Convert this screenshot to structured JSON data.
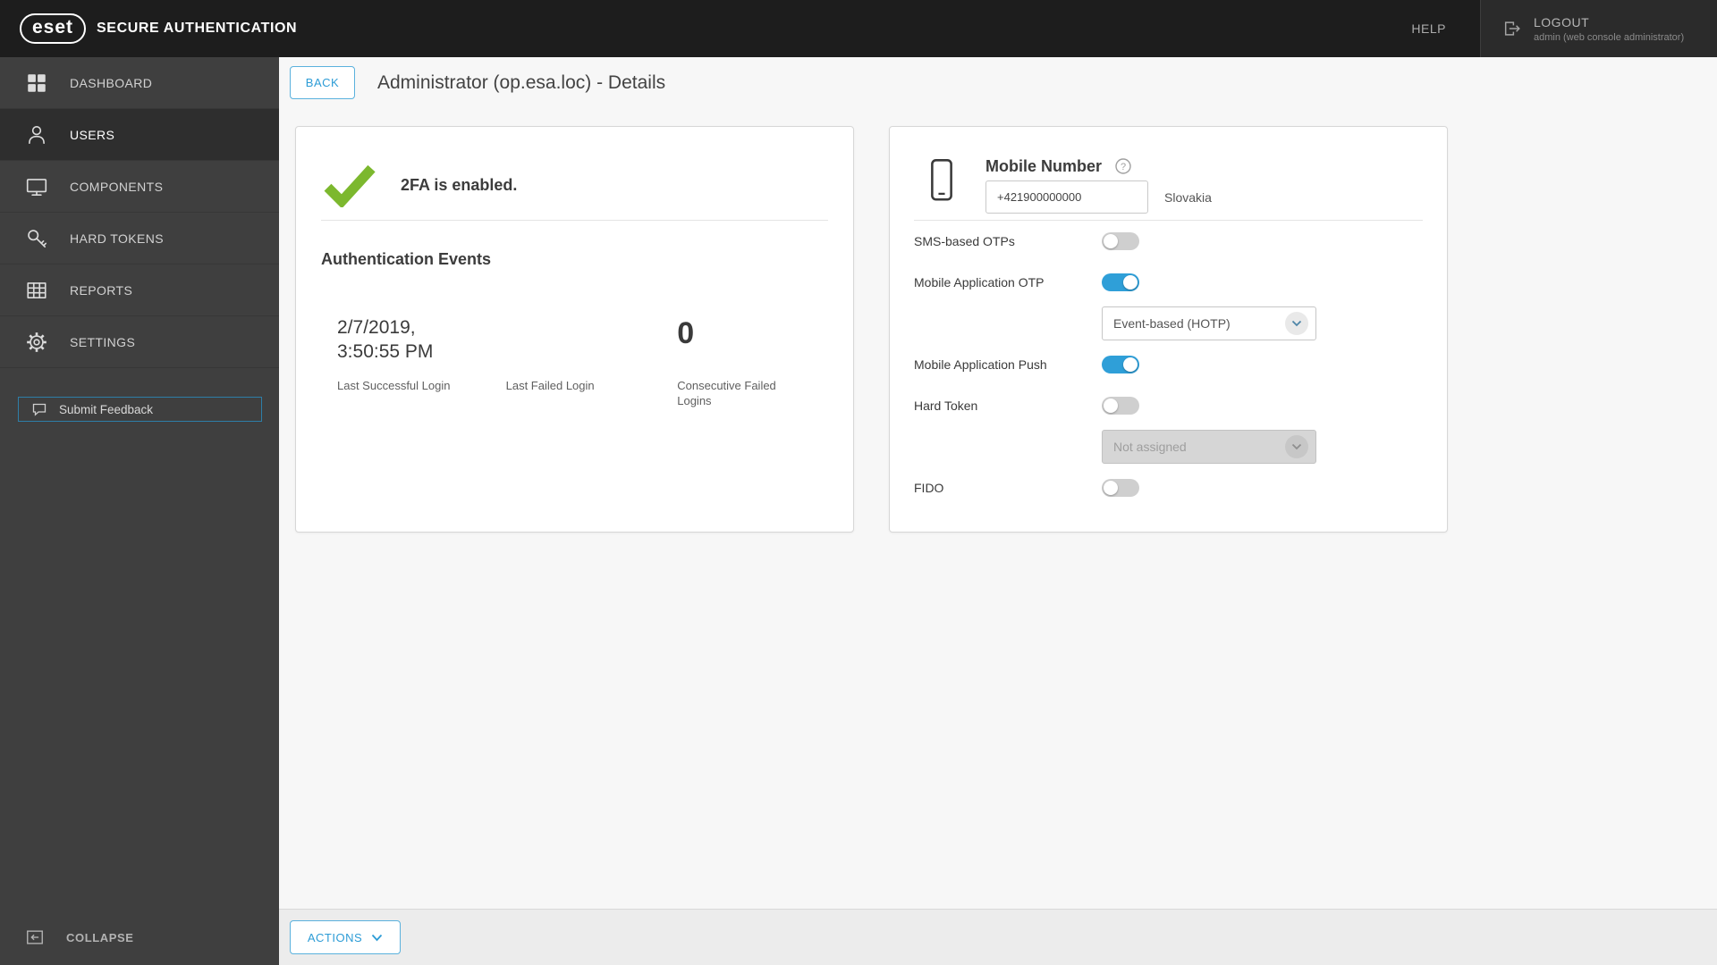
{
  "topbar": {
    "brand": "eset",
    "app_title": "SECURE AUTHENTICATION",
    "help_label": "HELP",
    "logout_label": "LOGOUT",
    "logout_sub": "admin (web console administrator)"
  },
  "sidebar": {
    "items": [
      {
        "label": "DASHBOARD",
        "selected": false
      },
      {
        "label": "USERS",
        "selected": true
      },
      {
        "label": "COMPONENTS",
        "selected": false
      },
      {
        "label": "HARD TOKENS",
        "selected": false
      },
      {
        "label": "REPORTS",
        "selected": false
      },
      {
        "label": "SETTINGS",
        "selected": false
      }
    ],
    "feedback_label": "Submit Feedback",
    "collapse_label": "COLLAPSE"
  },
  "header": {
    "back_label": "BACK",
    "title": "Administrator (op.esa.loc) - Details"
  },
  "status_card": {
    "enabled_text": "2FA is enabled.",
    "events_title": "Authentication Events",
    "stats": [
      {
        "value": "2/7/2019, 3:50:55 PM",
        "label": "Last Successful Login"
      },
      {
        "value": "",
        "label": "Last Failed Login"
      },
      {
        "value": "0",
        "label": "Consecutive Failed Logins"
      }
    ]
  },
  "mobile_card": {
    "title": "Mobile Number",
    "phone_value": "+421900000000",
    "country": "Slovakia",
    "rows": {
      "sms": {
        "label": "SMS-based OTPs",
        "on": false
      },
      "otp": {
        "label": "Mobile Application OTP",
        "on": true
      },
      "otp_type": {
        "value": "Event-based (HOTP)",
        "disabled": false
      },
      "push": {
        "label": "Mobile Application Push",
        "on": true
      },
      "hard_token": {
        "label": "Hard Token",
        "on": false
      },
      "hard_token_select": {
        "value": "Not assigned",
        "disabled": true
      },
      "fido": {
        "label": "FIDO",
        "on": false
      }
    }
  },
  "footer": {
    "actions_label": "ACTIONS"
  },
  "colors": {
    "accent": "#2f9fd8",
    "success_green": "#7cb82e",
    "topbar_bg": "#1d1d1d",
    "sidebar_bg": "#3f3f3f"
  }
}
